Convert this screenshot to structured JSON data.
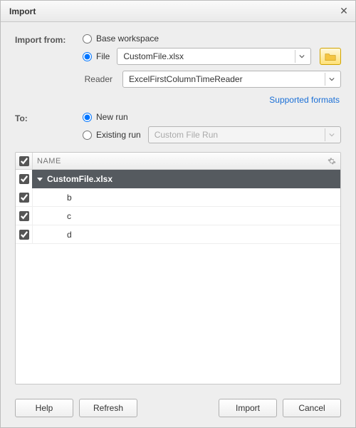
{
  "title": "Import",
  "labels": {
    "import_from": "Import from:",
    "to": "To:",
    "reader": "Reader",
    "file": "File",
    "base_workspace": "Base workspace",
    "new_run": "New run",
    "existing_run": "Existing run"
  },
  "source": {
    "selected": "file",
    "file_value": "CustomFile.xlsx",
    "reader_value": "ExcelFirstColumnTimeReader"
  },
  "link_supported_formats": "Supported formats",
  "destination": {
    "selected": "new_run",
    "existing_run_placeholder": "Custom File Run"
  },
  "tree": {
    "header_name": "NAME",
    "select_all": true,
    "root": {
      "checked": true,
      "label": "CustomFile.xlsx",
      "expanded": true
    },
    "children": [
      {
        "checked": true,
        "label": "b"
      },
      {
        "checked": true,
        "label": "c"
      },
      {
        "checked": true,
        "label": "d"
      }
    ]
  },
  "buttons": {
    "help": "Help",
    "refresh": "Refresh",
    "import": "Import",
    "cancel": "Cancel"
  }
}
